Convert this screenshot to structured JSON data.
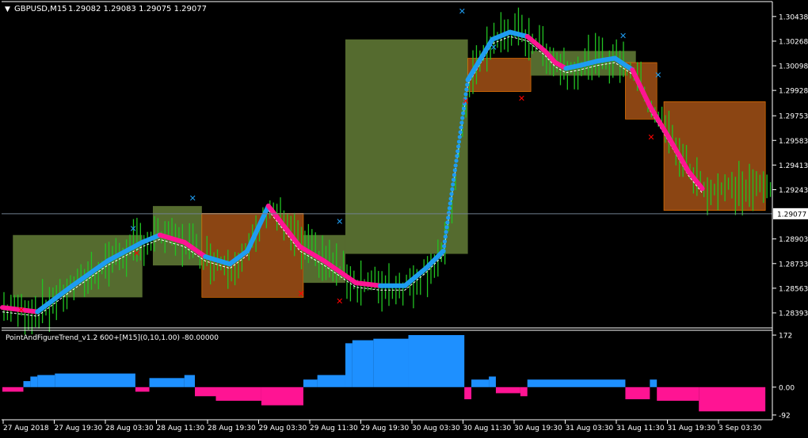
{
  "header": {
    "menu_glyph": "▼",
    "symbol_label": "GBPUSD,M15",
    "ohlc_label": "1.29082 1.29083 1.29075 1.29077"
  },
  "indicator": {
    "label": "PointAndFigureTrend_v1.2 600+[M15](0,10,1.00) -80.00000"
  },
  "colors": {
    "background": "#000000",
    "candles": "#22c322",
    "bull_box": "#556b2f",
    "bear_box": "#8b4513",
    "bear_box_border": "#ff7f00",
    "trend_up": "#1e9cf0",
    "trend_down": "#ff1493",
    "dotted_line": "#00bfff",
    "marker_up": "#1e9cf0",
    "marker_down": "#ff0000",
    "hist_pos": "#1e90ff",
    "hist_neg": "#ff1493",
    "grid_axis": "#ffffff",
    "current_price_line": "#708090"
  },
  "chart_data": [
    {
      "type": "line",
      "title": "GBPUSD,M15",
      "ylim": [
        1.283,
        1.3053
      ],
      "y_ticks": [
        "1.30438",
        "1.30268",
        "1.30098",
        "1.29928",
        "1.29753",
        "1.29583",
        "1.29413",
        "1.29243",
        "1.28903",
        "1.28733",
        "1.28563",
        "1.28393"
      ],
      "current_price": "1.29077",
      "x_ticks": [
        "27 Aug 2018",
        "27 Aug 19:30",
        "28 Aug 03:30",
        "28 Aug 11:30",
        "28 Aug 19:30",
        "29 Aug 03:30",
        "29 Aug 11:30",
        "29 Aug 19:30",
        "30 Aug 03:30",
        "30 Aug 11:30",
        "30 Aug 19:30",
        "31 Aug 03:30",
        "31 Aug 11:30",
        "31 Aug 19:30",
        "3 Sep 03:30"
      ],
      "trend_line": {
        "x": [
          0,
          10,
          20,
          30,
          40,
          45,
          52,
          58,
          65,
          70,
          76,
          85,
          92,
          101,
          108,
          115,
          121,
          126,
          133,
          140,
          145,
          150,
          155,
          158,
          161,
          165,
          170,
          175,
          180,
          185,
          190,
          196,
          200
        ],
        "y": [
          1.2843,
          1.284,
          1.2858,
          1.2875,
          1.2888,
          1.2893,
          1.2888,
          1.2878,
          1.2873,
          1.2882,
          1.2913,
          1.2885,
          1.2875,
          1.286,
          1.2858,
          1.2858,
          1.287,
          1.2882,
          1.3,
          1.3028,
          1.3033,
          1.303,
          1.302,
          1.3012,
          1.3008,
          1.301,
          1.3013,
          1.3015,
          1.3007,
          1.2982,
          1.2962,
          1.2937,
          1.2925
        ],
        "direction": [
          "down",
          "up",
          "up",
          "up",
          "up",
          "down",
          "down",
          "up",
          "up",
          "up",
          "down",
          "down",
          "down",
          "down",
          "up",
          "up",
          "up",
          "up",
          "up",
          "up",
          "up",
          "down",
          "down",
          "down",
          "up",
          "up",
          "up",
          "up",
          "down",
          "down",
          "down",
          "down",
          "down"
        ]
      },
      "boxes": [
        {
          "x0": 3,
          "x1": 40,
          "y_low": 1.285,
          "y_high": 1.2893,
          "dir": "up"
        },
        {
          "x0": 43,
          "x1": 57,
          "y_low": 1.2872,
          "y_high": 1.2913,
          "dir": "up"
        },
        {
          "x0": 57,
          "x1": 86,
          "y_low": 1.285,
          "y_high": 1.2908,
          "dir": "down"
        },
        {
          "x0": 86,
          "x1": 98,
          "y_low": 1.286,
          "y_high": 1.2893,
          "dir": "up"
        },
        {
          "x0": 98,
          "x1": 133,
          "y_low": 1.288,
          "y_high": 1.3028,
          "dir": "up"
        },
        {
          "x0": 133,
          "x1": 151,
          "y_low": 1.2992,
          "y_high": 1.3015,
          "dir": "down"
        },
        {
          "x0": 151,
          "x1": 181,
          "y_low": 1.3003,
          "y_high": 1.302,
          "dir": "up"
        },
        {
          "x0": 178,
          "x1": 187,
          "y_low": 1.2973,
          "y_high": 1.3012,
          "dir": "down"
        },
        {
          "x0": 189,
          "x1": 218,
          "y_low": 1.291,
          "y_high": 1.2985,
          "dir": "down"
        }
      ]
    },
    {
      "type": "bar",
      "title": "PointAndFigureTrend_v1.2 600+[M15](0,10,1.00) -80.00000",
      "ylim": [
        -100,
        180
      ],
      "y_ticks": [
        "172",
        "0.00",
        "-92"
      ],
      "segments": [
        {
          "x0": 0,
          "x1": 6,
          "value": -15
        },
        {
          "x0": 6,
          "x1": 8,
          "value": 20
        },
        {
          "x0": 8,
          "x1": 10,
          "value": 35
        },
        {
          "x0": 10,
          "x1": 15,
          "value": 40
        },
        {
          "x0": 15,
          "x1": 38,
          "value": 45
        },
        {
          "x0": 38,
          "x1": 42,
          "value": -15
        },
        {
          "x0": 42,
          "x1": 52,
          "value": 30
        },
        {
          "x0": 52,
          "x1": 55,
          "value": 40
        },
        {
          "x0": 55,
          "x1": 61,
          "value": -30
        },
        {
          "x0": 61,
          "x1": 74,
          "value": -45
        },
        {
          "x0": 74,
          "x1": 86,
          "value": -60
        },
        {
          "x0": 86,
          "x1": 90,
          "value": 25
        },
        {
          "x0": 90,
          "x1": 98,
          "value": 40
        },
        {
          "x0": 98,
          "x1": 100,
          "value": 145
        },
        {
          "x0": 100,
          "x1": 106,
          "value": 155
        },
        {
          "x0": 106,
          "x1": 116,
          "value": 160
        },
        {
          "x0": 116,
          "x1": 132,
          "value": 172
        },
        {
          "x0": 132,
          "x1": 134,
          "value": -40
        },
        {
          "x0": 134,
          "x1": 139,
          "value": 25
        },
        {
          "x0": 139,
          "x1": 141,
          "value": 35
        },
        {
          "x0": 141,
          "x1": 148,
          "value": -20
        },
        {
          "x0": 148,
          "x1": 150,
          "value": -30
        },
        {
          "x0": 150,
          "x1": 178,
          "value": 25
        },
        {
          "x0": 178,
          "x1": 185,
          "value": -40
        },
        {
          "x0": 185,
          "x1": 187,
          "value": 25
        },
        {
          "x0": 187,
          "x1": 199,
          "value": -45
        },
        {
          "x0": 199,
          "x1": 218,
          "value": -80
        }
      ]
    }
  ]
}
